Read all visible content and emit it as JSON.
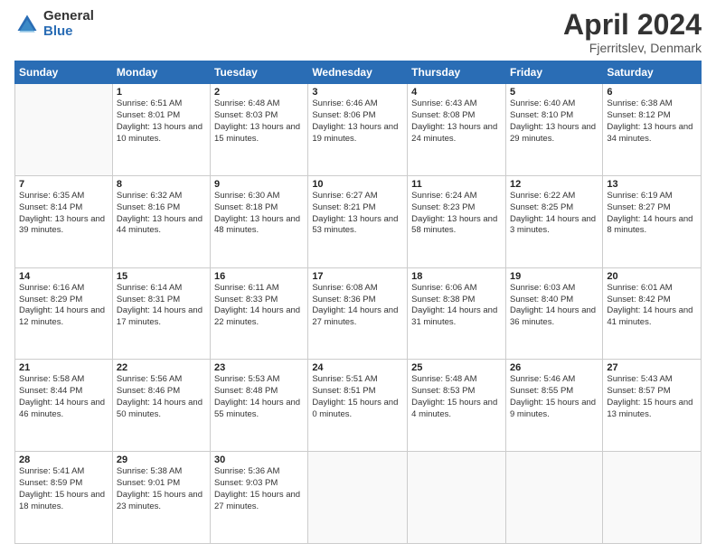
{
  "logo": {
    "general": "General",
    "blue": "Blue"
  },
  "title": {
    "month": "April 2024",
    "location": "Fjerritslev, Denmark"
  },
  "weekdays": [
    "Sunday",
    "Monday",
    "Tuesday",
    "Wednesday",
    "Thursday",
    "Friday",
    "Saturday"
  ],
  "weeks": [
    [
      {
        "day": "",
        "sunrise": "",
        "sunset": "",
        "daylight": ""
      },
      {
        "day": "1",
        "sunrise": "Sunrise: 6:51 AM",
        "sunset": "Sunset: 8:01 PM",
        "daylight": "Daylight: 13 hours and 10 minutes."
      },
      {
        "day": "2",
        "sunrise": "Sunrise: 6:48 AM",
        "sunset": "Sunset: 8:03 PM",
        "daylight": "Daylight: 13 hours and 15 minutes."
      },
      {
        "day": "3",
        "sunrise": "Sunrise: 6:46 AM",
        "sunset": "Sunset: 8:06 PM",
        "daylight": "Daylight: 13 hours and 19 minutes."
      },
      {
        "day": "4",
        "sunrise": "Sunrise: 6:43 AM",
        "sunset": "Sunset: 8:08 PM",
        "daylight": "Daylight: 13 hours and 24 minutes."
      },
      {
        "day": "5",
        "sunrise": "Sunrise: 6:40 AM",
        "sunset": "Sunset: 8:10 PM",
        "daylight": "Daylight: 13 hours and 29 minutes."
      },
      {
        "day": "6",
        "sunrise": "Sunrise: 6:38 AM",
        "sunset": "Sunset: 8:12 PM",
        "daylight": "Daylight: 13 hours and 34 minutes."
      }
    ],
    [
      {
        "day": "7",
        "sunrise": "Sunrise: 6:35 AM",
        "sunset": "Sunset: 8:14 PM",
        "daylight": "Daylight: 13 hours and 39 minutes."
      },
      {
        "day": "8",
        "sunrise": "Sunrise: 6:32 AM",
        "sunset": "Sunset: 8:16 PM",
        "daylight": "Daylight: 13 hours and 44 minutes."
      },
      {
        "day": "9",
        "sunrise": "Sunrise: 6:30 AM",
        "sunset": "Sunset: 8:18 PM",
        "daylight": "Daylight: 13 hours and 48 minutes."
      },
      {
        "day": "10",
        "sunrise": "Sunrise: 6:27 AM",
        "sunset": "Sunset: 8:21 PM",
        "daylight": "Daylight: 13 hours and 53 minutes."
      },
      {
        "day": "11",
        "sunrise": "Sunrise: 6:24 AM",
        "sunset": "Sunset: 8:23 PM",
        "daylight": "Daylight: 13 hours and 58 minutes."
      },
      {
        "day": "12",
        "sunrise": "Sunrise: 6:22 AM",
        "sunset": "Sunset: 8:25 PM",
        "daylight": "Daylight: 14 hours and 3 minutes."
      },
      {
        "day": "13",
        "sunrise": "Sunrise: 6:19 AM",
        "sunset": "Sunset: 8:27 PM",
        "daylight": "Daylight: 14 hours and 8 minutes."
      }
    ],
    [
      {
        "day": "14",
        "sunrise": "Sunrise: 6:16 AM",
        "sunset": "Sunset: 8:29 PM",
        "daylight": "Daylight: 14 hours and 12 minutes."
      },
      {
        "day": "15",
        "sunrise": "Sunrise: 6:14 AM",
        "sunset": "Sunset: 8:31 PM",
        "daylight": "Daylight: 14 hours and 17 minutes."
      },
      {
        "day": "16",
        "sunrise": "Sunrise: 6:11 AM",
        "sunset": "Sunset: 8:33 PM",
        "daylight": "Daylight: 14 hours and 22 minutes."
      },
      {
        "day": "17",
        "sunrise": "Sunrise: 6:08 AM",
        "sunset": "Sunset: 8:36 PM",
        "daylight": "Daylight: 14 hours and 27 minutes."
      },
      {
        "day": "18",
        "sunrise": "Sunrise: 6:06 AM",
        "sunset": "Sunset: 8:38 PM",
        "daylight": "Daylight: 14 hours and 31 minutes."
      },
      {
        "day": "19",
        "sunrise": "Sunrise: 6:03 AM",
        "sunset": "Sunset: 8:40 PM",
        "daylight": "Daylight: 14 hours and 36 minutes."
      },
      {
        "day": "20",
        "sunrise": "Sunrise: 6:01 AM",
        "sunset": "Sunset: 8:42 PM",
        "daylight": "Daylight: 14 hours and 41 minutes."
      }
    ],
    [
      {
        "day": "21",
        "sunrise": "Sunrise: 5:58 AM",
        "sunset": "Sunset: 8:44 PM",
        "daylight": "Daylight: 14 hours and 46 minutes."
      },
      {
        "day": "22",
        "sunrise": "Sunrise: 5:56 AM",
        "sunset": "Sunset: 8:46 PM",
        "daylight": "Daylight: 14 hours and 50 minutes."
      },
      {
        "day": "23",
        "sunrise": "Sunrise: 5:53 AM",
        "sunset": "Sunset: 8:48 PM",
        "daylight": "Daylight: 14 hours and 55 minutes."
      },
      {
        "day": "24",
        "sunrise": "Sunrise: 5:51 AM",
        "sunset": "Sunset: 8:51 PM",
        "daylight": "Daylight: 15 hours and 0 minutes."
      },
      {
        "day": "25",
        "sunrise": "Sunrise: 5:48 AM",
        "sunset": "Sunset: 8:53 PM",
        "daylight": "Daylight: 15 hours and 4 minutes."
      },
      {
        "day": "26",
        "sunrise": "Sunrise: 5:46 AM",
        "sunset": "Sunset: 8:55 PM",
        "daylight": "Daylight: 15 hours and 9 minutes."
      },
      {
        "day": "27",
        "sunrise": "Sunrise: 5:43 AM",
        "sunset": "Sunset: 8:57 PM",
        "daylight": "Daylight: 15 hours and 13 minutes."
      }
    ],
    [
      {
        "day": "28",
        "sunrise": "Sunrise: 5:41 AM",
        "sunset": "Sunset: 8:59 PM",
        "daylight": "Daylight: 15 hours and 18 minutes."
      },
      {
        "day": "29",
        "sunrise": "Sunrise: 5:38 AM",
        "sunset": "Sunset: 9:01 PM",
        "daylight": "Daylight: 15 hours and 23 minutes."
      },
      {
        "day": "30",
        "sunrise": "Sunrise: 5:36 AM",
        "sunset": "Sunset: 9:03 PM",
        "daylight": "Daylight: 15 hours and 27 minutes."
      },
      {
        "day": "",
        "sunrise": "",
        "sunset": "",
        "daylight": ""
      },
      {
        "day": "",
        "sunrise": "",
        "sunset": "",
        "daylight": ""
      },
      {
        "day": "",
        "sunrise": "",
        "sunset": "",
        "daylight": ""
      },
      {
        "day": "",
        "sunrise": "",
        "sunset": "",
        "daylight": ""
      }
    ]
  ]
}
